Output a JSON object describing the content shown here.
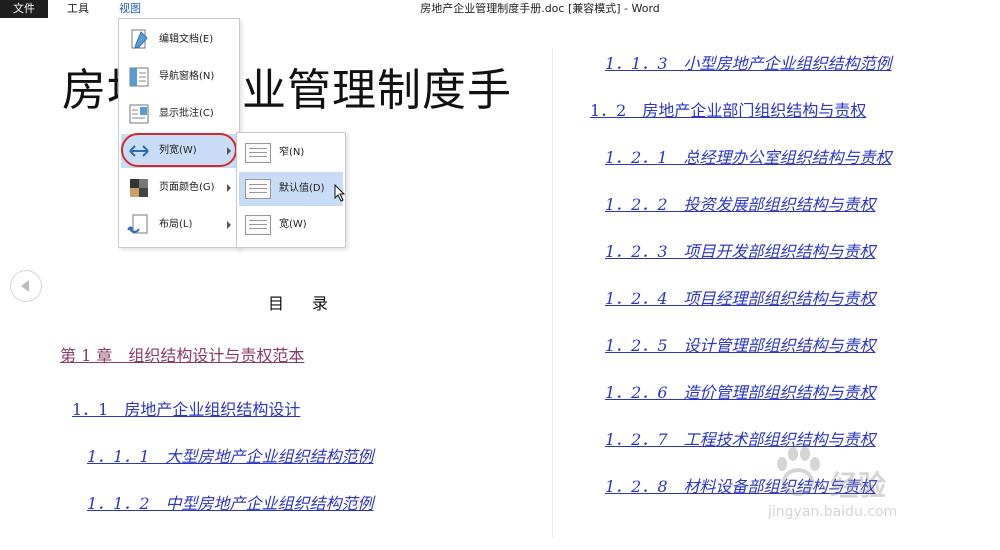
{
  "menubar": {
    "file": "文件",
    "tools": "工具",
    "view": "视图",
    "title": "房地产企业管理制度手册.doc [兼容模式] - Word"
  },
  "view_menu": {
    "items": [
      {
        "label": "编辑文档(E)",
        "icon": "edit-document-icon"
      },
      {
        "label": "导航窗格(N)",
        "icon": "navigation-pane-icon"
      },
      {
        "label": "显示批注(C)",
        "icon": "show-comments-icon"
      },
      {
        "label": "列宽(W)",
        "icon": "column-width-icon",
        "has_submenu": true,
        "active": true
      },
      {
        "label": "页面颜色(G)",
        "icon": "page-color-icon",
        "has_submenu": true
      },
      {
        "label": "布局(L)",
        "icon": "layout-icon",
        "has_submenu": true
      }
    ]
  },
  "column_width_submenu": {
    "items": [
      {
        "label": "窄(N)"
      },
      {
        "label": "默认值(D)",
        "active": true
      },
      {
        "label": "宽(W)"
      }
    ]
  },
  "document": {
    "title": "房地产企业管理制度手",
    "toc_heading": "目　录",
    "left_entries": [
      "第 1 章　组织结构设计与责权范本",
      "1．1　房地产企业组织结构设计",
      "1．1．1　大型房地产企业组织结构范例",
      "1．1．2　中型房地产企业组织结构范例"
    ],
    "right_entries": [
      "1．1．3　小型房地产企业组织结构范例",
      "1．2　房地产企业部门组织结构与责权",
      "1．2．1　总经理办公室组织结构与责权",
      "1．2．2　投资发展部组织结构与责权",
      "1．2．3　项目开发部组织结构与责权",
      "1．2．4　项目经理部组织结构与责权",
      "1．2．5　设计管理部组织结构与责权",
      "1．2．6　造价管理部组织结构与责权",
      "1．2．7　工程技术部组织结构与责权",
      "1．2．8　材料设备部组织结构与责权"
    ]
  },
  "watermark": {
    "brand": "经验",
    "url": "jingyan.baidu.com"
  },
  "colors": {
    "link": "#2a35c9",
    "chapter": "#8b3b66",
    "highlight_ring": "#d22a2a",
    "menu_active": "#c9dcf5"
  }
}
